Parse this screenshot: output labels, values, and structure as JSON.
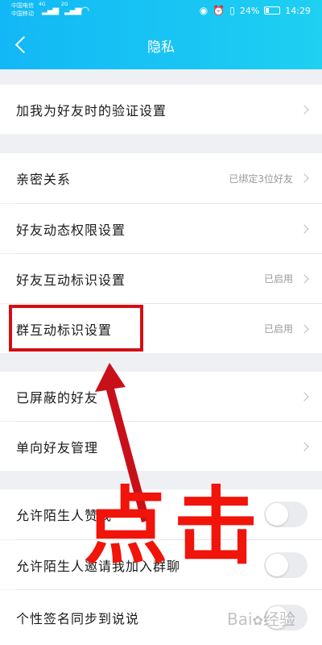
{
  "status": {
    "carrier1": "中国电信",
    "carrier2": "中国移动",
    "net1": "4G",
    "net2": "2G",
    "battery": "24%",
    "time": "14:29"
  },
  "header": {
    "title": "隐私"
  },
  "sections": [
    {
      "label": "加我为好友时的验证设置",
      "value": ""
    },
    {
      "label": "亲密关系",
      "value": "已绑定3位好友"
    },
    {
      "label": "好友动态权限设置",
      "value": ""
    },
    {
      "label": "好友互动标识设置",
      "value": "已启用"
    },
    {
      "label": "群互动标识设置",
      "value": "已启用"
    },
    {
      "label": "已屏蔽的好友",
      "value": ""
    },
    {
      "label": "单向好友管理",
      "value": ""
    },
    {
      "label": "允许陌生人赞我",
      "value": ""
    },
    {
      "label": "允许陌生人邀请我加入群聊",
      "value": ""
    },
    {
      "label": "个性签名同步到说说",
      "value": ""
    }
  ],
  "toggles": {
    "stranger_like": false,
    "stranger_invite": false,
    "signature_sync": false
  },
  "annotation": {
    "text": "点击",
    "color": "#f0140a",
    "box_color": "#d10f14"
  },
  "watermark": {
    "text": "Bai",
    "text2": "经验"
  }
}
